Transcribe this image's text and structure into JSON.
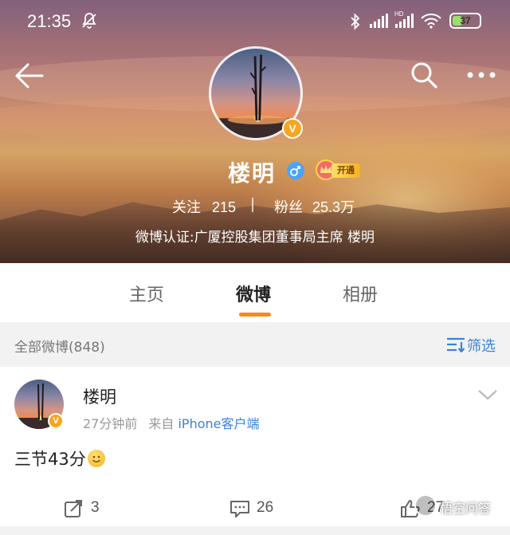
{
  "status_bar": {
    "time": "21:35",
    "battery": "37",
    "battery_level": 0.37,
    "icons": [
      "mute-notifications-icon",
      "bluetooth-icon",
      "signal-icon",
      "hd-signal-icon",
      "wifi-icon",
      "battery-icon"
    ]
  },
  "nav": {
    "back_icon": "back-arrow-icon",
    "search_icon": "search-icon",
    "more_icon": "more-icon"
  },
  "profile": {
    "name": "楼明",
    "verified_badge": "V",
    "gender_icon": "male-icon",
    "vip_label": "开通",
    "follow_label": "关注",
    "follow_count": "215",
    "fans_label": "粉丝",
    "fans_count": "25.3万",
    "verification": "微博认证:广厦控股集团董事局主席 楼明"
  },
  "tabs": [
    {
      "label": "主页",
      "active": false
    },
    {
      "label": "微博",
      "active": true
    },
    {
      "label": "相册",
      "active": false
    }
  ],
  "filter": {
    "count_text": "全部微博(848)",
    "button_label": "筛选"
  },
  "post": {
    "author": "楼明",
    "time": "27分钟前",
    "source_prefix": "来自",
    "source": "iPhone客户端",
    "text": "三节43分",
    "emoji": "smile-emoji",
    "reposts": "3",
    "comments": "26",
    "likes": "27"
  },
  "watermark": {
    "text": "悟空问答"
  },
  "colors": {
    "accent_orange": "#f58a1f",
    "link_blue": "#3a82d8",
    "verified_gold": "#f5a623"
  }
}
